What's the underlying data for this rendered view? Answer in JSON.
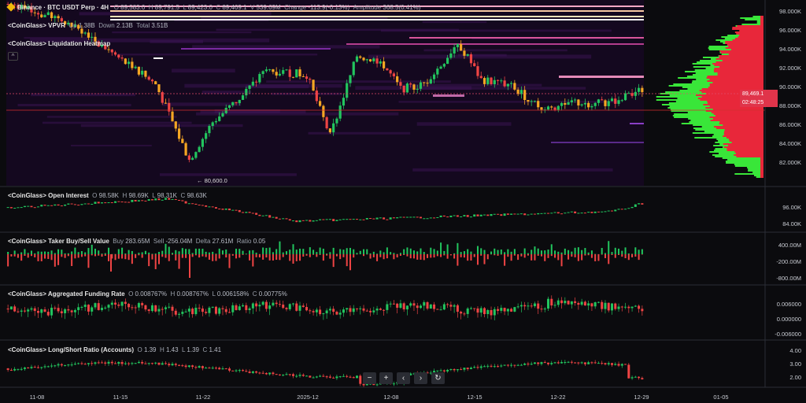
{
  "colors": {
    "up": "#22c55e",
    "down": "#ef4444",
    "bg": "#0b0b0e",
    "heat": "#2a0d3f",
    "accent": "#f0b90b"
  },
  "icons": [
    "binance-logo-icon",
    "minus-icon",
    "plus-icon",
    "chevron-left-icon",
    "chevron-right-icon",
    "reset-icon",
    "chevron-up-icon"
  ],
  "main": {
    "symbol": "Binance · BTC USDT Perp · 4H",
    "o_label": "O",
    "o": "89,583.0",
    "h_label": "H",
    "h": "89,791.5",
    "l_label": "L",
    "l": "89,423.0",
    "c_label": "C",
    "c": "89,469.1",
    "v_label": "V",
    "v": "539.69M",
    "change_label": "Change",
    "change": "-113.9(-0.13%)",
    "amp_label": "Amplitude",
    "amp": "368.5(0.41%)",
    "vpvr_title": "<CoinGlass> VPVR",
    "vpvr_up_label": "Up",
    "vpvr_up": "1.38B",
    "vpvr_down_label": "Down",
    "vpvr_down": "2.13B",
    "vpvr_total_label": "Total",
    "vpvr_total": "3.51B",
    "heatmap_title": "<CoinGlass> Liquidation Heatmap",
    "low_label": "80,600.0",
    "price_tag": "89,469.1",
    "countdown_tag": "02:48:25",
    "axis": [
      "98.000K",
      "96.000K",
      "94.000K",
      "92.000K",
      "90.000K",
      "88.000K",
      "86.000K",
      "84.000K",
      "82.000K"
    ]
  },
  "oi": {
    "title": "<CoinGlass> Open Interest",
    "o_label": "O",
    "o": "98.58K",
    "h_label": "H",
    "h": "98.69K",
    "l_label": "L",
    "l": "98.31K",
    "c_label": "C",
    "c": "98.63K",
    "axis": [
      "96.00K",
      "84.00K"
    ]
  },
  "taker": {
    "title": "<CoinGlass> Taker Buy/Sell Value",
    "buy_label": "Buy",
    "buy": "283.65M",
    "sell_label": "Sell",
    "sell": "-256.04M",
    "delta_label": "Delta",
    "delta": "27.61M",
    "ratio_label": "Ratio",
    "ratio": "0.05",
    "axis": [
      "400.00M",
      "-200.00M",
      "-800.00M"
    ]
  },
  "funding": {
    "title": "<CoinGlass> Aggregated Funding Rate",
    "o_label": "O",
    "o": "0.008767%",
    "h_label": "H",
    "h": "0.008767%",
    "l_label": "L",
    "l": "0.006158%",
    "c_label": "C",
    "c": "0.00775%",
    "axis": [
      "0.006000",
      "0.000000",
      "-0.006000"
    ]
  },
  "ls": {
    "title": "<CoinGlass> Long/Short Ratio (Accounts)",
    "o_label": "O",
    "o": "1.39",
    "h_label": "H",
    "h": "1.43",
    "l_label": "L",
    "l": "1.39",
    "c_label": "C",
    "c": "1.41",
    "axis": [
      "4.00",
      "3.00",
      "2.00"
    ]
  },
  "xaxis": [
    "11-08",
    "11-15",
    "11-22",
    "2025-12",
    "12-08",
    "12-15",
    "12-22",
    "12-29",
    "01-05"
  ],
  "toolbar": {
    "zoom_out": "−",
    "zoom_in": "+",
    "back": "‹",
    "forward": "›",
    "reset": "↻",
    "collapse": "^"
  }
}
